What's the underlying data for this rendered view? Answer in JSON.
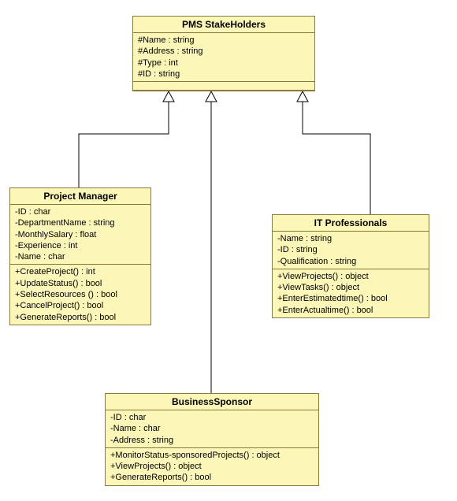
{
  "stakeholders": {
    "title": "PMS StakeHolders",
    "attr0": "#Name : string",
    "attr1": "#Address : string",
    "attr2": "#Type : int",
    "attr3": "#ID : string"
  },
  "pm": {
    "title": "Project Manager",
    "attr0": "-ID : char",
    "attr1": "-DepartmentName : string",
    "attr2": "-MonthlySalary : float",
    "attr3": "-Experience : int",
    "attr4": "-Name : char",
    "op0": "+CreateProject() : int",
    "op1": "+UpdateStatus() : bool",
    "op2": "+SelectResources () : bool",
    "op3": "+CancelProject() : bool",
    "op4": "+GenerateReports() : bool"
  },
  "it": {
    "title": "IT Professionals",
    "attr0": "-Name : string",
    "attr1": "-ID : string",
    "attr2": "-Qualification : string",
    "op0": "+ViewProjects() : object",
    "op1": "+ViewTasks() : object",
    "op2": "+EnterEstimatedtime() : bool",
    "op3": "+EnterActualtime() : bool"
  },
  "bs": {
    "title": "BusinessSponsor",
    "attr0": "-ID : char",
    "attr1": "-Name : char",
    "attr2": "-Address : string",
    "op0": "+MonitorStatus-sponsoredProjects() : object",
    "op1": "+ViewProjects() : object",
    "op2": "+GenerateReports() : bool"
  }
}
